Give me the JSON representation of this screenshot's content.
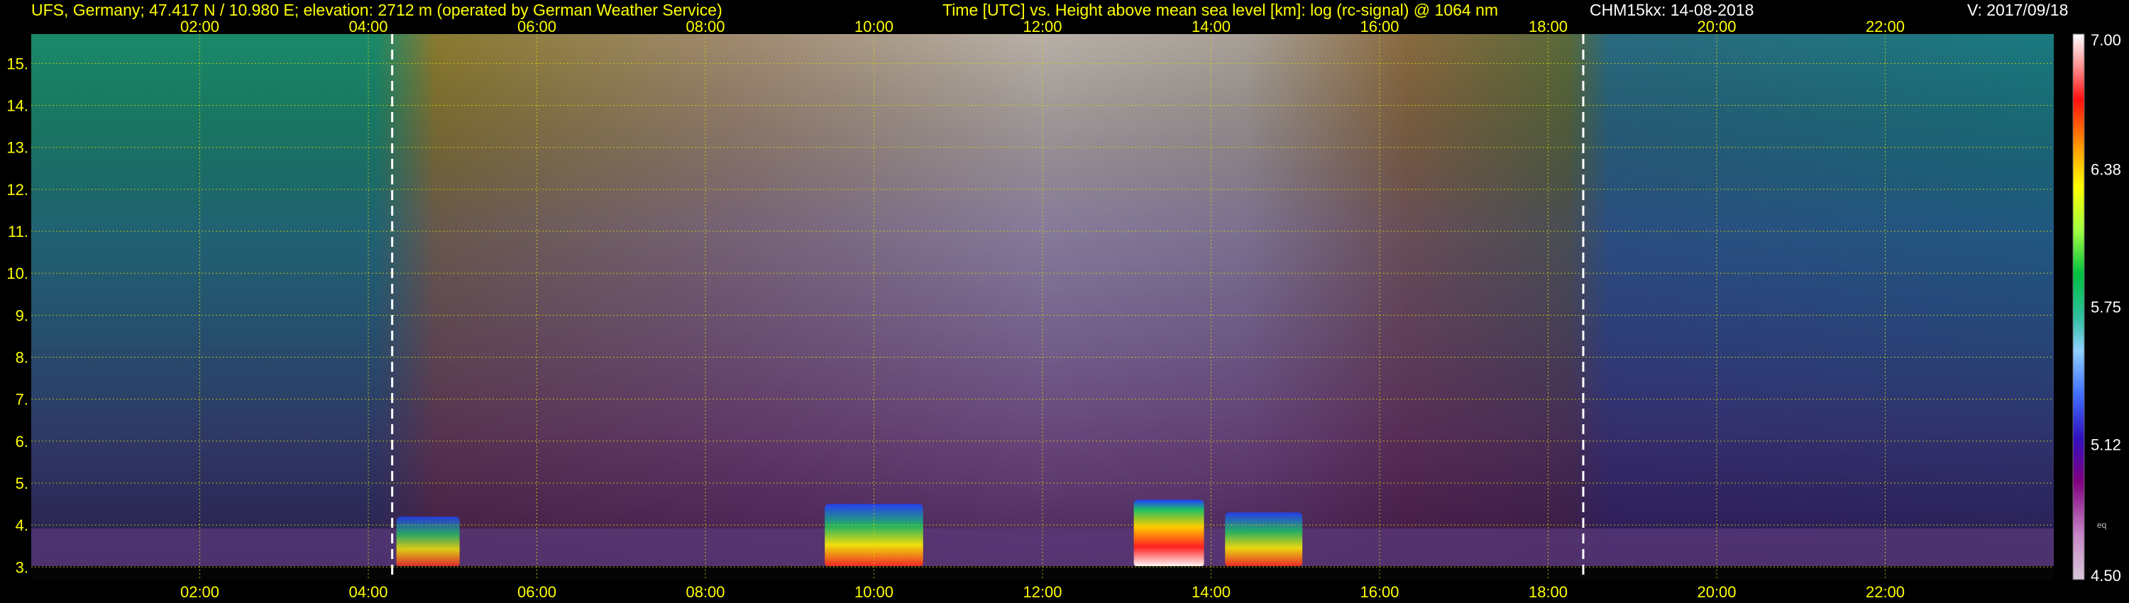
{
  "header": {
    "station": "UFS, Germany; 47.417 N / 10.980 E; elevation: 2712 m  (operated by German Weather Service)",
    "axis_info": "Time [UTC] vs. Height above mean sea level [km]: log (rc-signal) @ 1064 nm",
    "instrument_date": "CHM15kx: 14-08-2018",
    "version": "V: 2017/09/18"
  },
  "colors": {
    "header_text": "#ffff00",
    "grid": "#d8d800",
    "tick_text": "#ffff00",
    "marker_line": "#ffffff",
    "background": "#000000"
  },
  "chart_data": {
    "type": "heatmap",
    "title": "Time [UTC] vs. Height above mean sea level [km]: log (rc-signal) @ 1064 nm",
    "xlabel": "Time [UTC]",
    "ylabel": "Height above mean sea level [km]",
    "xlim_hours": [
      0.0,
      24.0
    ],
    "ylim_km": [
      2.7,
      15.7
    ],
    "x_ticks": [
      "02:00",
      "04:00",
      "06:00",
      "08:00",
      "10:00",
      "12:00",
      "14:00",
      "16:00",
      "18:00",
      "20:00",
      "22:00"
    ],
    "y_ticks": [
      "3.",
      "4.",
      "5.",
      "6.",
      "7.",
      "8.",
      "9.",
      "10.",
      "11.",
      "12.",
      "13.",
      "14.",
      "15."
    ],
    "grid": true,
    "sunrise_marker": "04:17",
    "sunset_marker": "18:25",
    "colorbar": {
      "min": 4.5,
      "max": 7.0,
      "tick_labels": [
        "7.00",
        "6.38",
        "5.75",
        "5.12",
        "4.50"
      ],
      "tick_values": [
        7.0,
        6.38,
        5.75,
        5.12,
        4.5
      ],
      "small_label": "eq"
    },
    "cloud_features": [
      {
        "start": "04:20",
        "end": "05:05",
        "base_km": 3.0,
        "top_km": 4.2,
        "intensity": 5.9
      },
      {
        "start": "09:25",
        "end": "10:35",
        "base_km": 3.0,
        "top_km": 4.5,
        "intensity": 6.5
      },
      {
        "start": "13:05",
        "end": "13:55",
        "base_km": 3.0,
        "top_km": 4.6,
        "intensity": 7.0
      },
      {
        "start": "14:10",
        "end": "15:05",
        "base_km": 3.0,
        "top_km": 4.3,
        "intensity": 6.3
      }
    ]
  }
}
